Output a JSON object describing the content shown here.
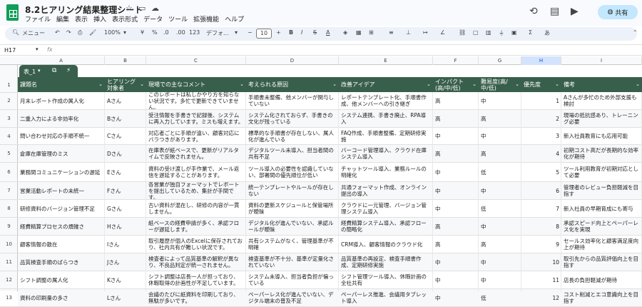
{
  "app": {
    "title": "8.2ヒアリング結果整理シート",
    "share_label": "共有",
    "menus": [
      "ファイル",
      "編集",
      "表示",
      "挿入",
      "表示形式",
      "データ",
      "ツール",
      "拡張機能",
      "ヘルプ"
    ]
  },
  "toolbar": {
    "search": "メニュー",
    "zoom": "100%",
    "currency": "¥",
    "percent": "%",
    "dec_minus": ".0",
    "dec_plus": ".00",
    "numfmt": "123",
    "font": "デフォ...",
    "fontsize": "10",
    "bold": "B",
    "italic": "I",
    "strike": "S",
    "textcolor": "A"
  },
  "formula": {
    "cell_ref": "H17",
    "fx": "fx"
  },
  "columns": [
    "A",
    "B",
    "C",
    "D",
    "E",
    "F",
    "G",
    "H",
    "I"
  ],
  "table": {
    "name": "表_1",
    "headers": [
      "課題名",
      "ヒアリング対象者",
      "現場での主なコメント",
      "考えられる原因",
      "改善アイデア",
      "インパクト(高/中/低)",
      "難易度(高/中/低)",
      "優先度",
      "備考"
    ],
    "rows": [
      [
        "月末レポート作成の属人化",
        "Aさん",
        "このレポートは私しかやり方を知らない状況です。多忙で更新できていません。",
        "手順書未整備、他メンバーが関与していない",
        "レポートテンプレート化、手順書作成、他メンバーへの引き継ぎ",
        "高",
        "中",
        "1",
        "Aさんが多忙のため外部支援も検討"
      ],
      [
        "二重入力による非効率化",
        "Bさん",
        "受注情報を手書きで記録後、システムに再入力しています。ミスも増えます。",
        "システム化されておらず、手書きの文化が残っている",
        "システム連携、手書き廃止、RPA導入",
        "高",
        "高",
        "2",
        "現場の抵抗感あり、トレーニング必要"
      ],
      [
        "問い合わせ対応の手順不統一",
        "Cさん",
        "対応者ごとに手順が違い、顧客対応にバラつきがあります。",
        "標準的な手順書が存在しない、属人化が進んでいる",
        "FAQ作成、手順書整備、定期研修実施",
        "中",
        "中",
        "3",
        "新入社員教育にも応用可能"
      ],
      [
        "倉庫在庫管理のミス",
        "Dさん",
        "在庫表が紙ベースで、更新がリアルタイムで反映されません。",
        "デジタルツール未導入、担当者間の共有不足",
        "バーコード管理導入、クラウド在庫システム導入",
        "高",
        "高",
        "4",
        "初期コスト高だが長期的な効率化が期待"
      ],
      [
        "業務間コミュニケーションの遅延",
        "Eさん",
        "資料の受け渡しが手作業で、メール返信を遅延することがあります。",
        "ツール導入の必要性を認識していない、部署間の優先順位が低い",
        "チャットツール導入、業務ルールの明確化",
        "中",
        "低",
        "5",
        "ツール利用教育が初期対応として必要"
      ],
      [
        "営業活動レポートの未統一",
        "Fさん",
        "各営業が独自フォーマットでレポートを提出しているため、集計が手間です。",
        "統一テンプレートやルールが存在しない",
        "共通フォーマット作成、オンライン提出の導入",
        "中",
        "中",
        "6",
        "管理者のレビュー負担軽減を目指す"
      ],
      [
        "研修資料のバージョン管理不足",
        "Gさん",
        "古い資料が混在し、研修の内容が一貫しません。",
        "資料の更新スケジュールと保管場所が曖昧",
        "クラウドに一元管理、バージョン管理システム導入",
        "中",
        "低",
        "7",
        "新入社員の早期育成にも寄与"
      ],
      [
        "経費精算プロセスの煩雑さ",
        "Hさん",
        "紙ベースの経費申請が多く、承認フローが遅延します。",
        "デジタル化が進んでいない、承認ルールが曖昧",
        "経費精算システム導入、承認フローの簡略化",
        "高",
        "中",
        "8",
        "承認スピード向上とペーパーレス化を実現"
      ],
      [
        "顧客情報の散在",
        "Iさん",
        "取引履歴が個人のExcelに保存されており、社内共有が難しい状況です。",
        "共有システムがなく、管理基準が不明確",
        "CRM導入、顧客情報のクラウド化",
        "高",
        "高",
        "9",
        "セールス効率化と顧客満足度向上が期待"
      ],
      [
        "品質検査手順のばらつき",
        "Jさん",
        "検査者によって品質基準の解釈が異なり、不良品判定が統一されません。",
        "検査基準が不十分、基準が定量化されていない",
        "品質基準の再設定、検査手順書作成、定期研修実施",
        "中",
        "中",
        "10",
        "取引先からの品質評価向上を目指す"
      ],
      [
        "シフト調整の属人化",
        "Kさん",
        "シフト調整は店長一人が担っており、休暇取得の計画性が不足しています。",
        "システム未導入、担当者負担が偏っている",
        "シフト管理ツール導入、休暇計画の全社共有",
        "中",
        "中",
        "11",
        "店長の負担軽減が期待"
      ],
      [
        "資料の印刷量の多さ",
        "Lさん",
        "会議のたびに紙資料を印刷しており、無駄が多いです。",
        "ペーパーレス化が進んでいない、デジタル端末の普及不足",
        "ペーパーレス推進、会議用タブレット導入",
        "中",
        "低",
        "12",
        "コスト削減とエコ意識向上を目指す"
      ]
    ]
  }
}
